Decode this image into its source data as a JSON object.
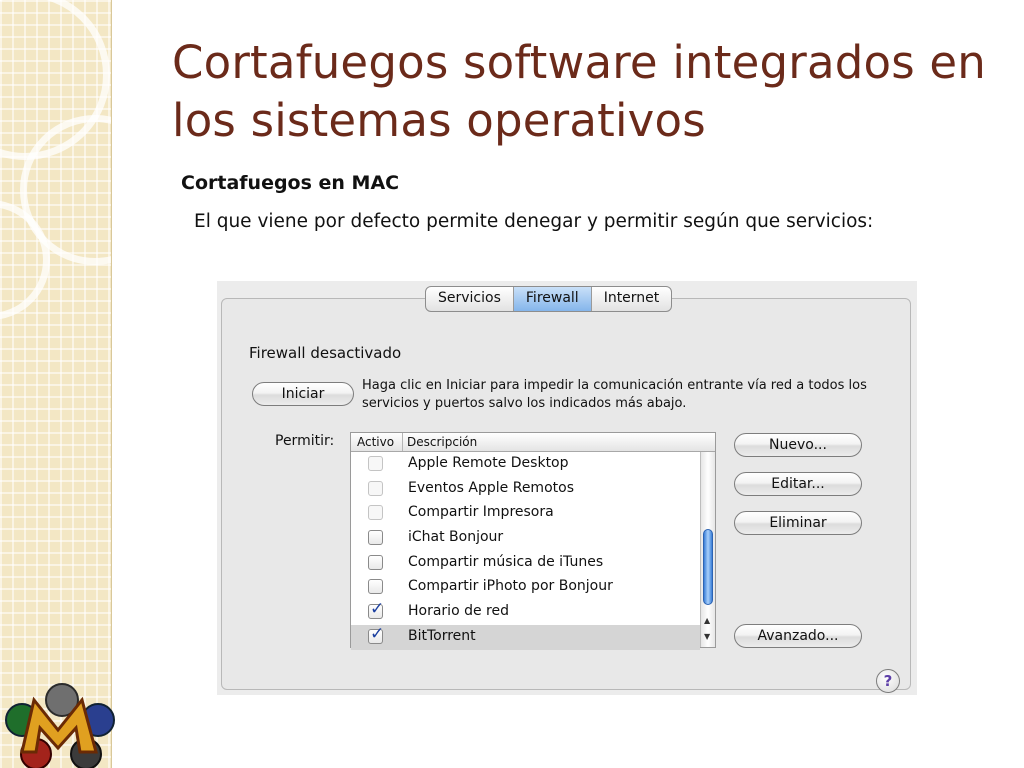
{
  "slide": {
    "title": "Cortafuegos software integrados en los sistemas operativos",
    "subtitle": "Cortafuegos en MAC",
    "body": "El que viene por defecto permite denegar y permitir según que servicios:"
  },
  "pane": {
    "tabs": [
      {
        "label": "Servicios",
        "active": false
      },
      {
        "label": "Firewall",
        "active": true
      },
      {
        "label": "Internet",
        "active": false
      }
    ],
    "status": "Firewall desactivado",
    "start_button": "Iniciar",
    "info": "Haga clic en Iniciar para impedir la comunicación entrante vía red a todos los servicios y puertos salvo los indicados más abajo.",
    "allow_label": "Permitir:",
    "list": {
      "headers": [
        "Activo",
        "Descripción"
      ],
      "rows": [
        {
          "label": "Apple Remote Desktop",
          "checked": false,
          "enabled": false
        },
        {
          "label": "Eventos Apple Remotos",
          "checked": false,
          "enabled": false
        },
        {
          "label": "Compartir Impresora",
          "checked": false,
          "enabled": false
        },
        {
          "label": "iChat Bonjour",
          "checked": false,
          "enabled": true
        },
        {
          "label": "Compartir música de iTunes",
          "checked": false,
          "enabled": true
        },
        {
          "label": "Compartir iPhoto por Bonjour",
          "checked": false,
          "enabled": true
        },
        {
          "label": "Horario de red",
          "checked": true,
          "enabled": true
        },
        {
          "label": "BitTorrent",
          "checked": true,
          "enabled": true,
          "selected": true
        }
      ]
    },
    "buttons": {
      "new": "Nuevo...",
      "edit": "Editar...",
      "delete": "Eliminar",
      "advanced": "Avanzado..."
    },
    "help": "?"
  },
  "icons": {
    "logo": "magic-m-logo-icon",
    "help": "help-icon",
    "checkbox": "checkbox-icon",
    "scroll_up": "arrow-up-icon",
    "scroll_down": "arrow-down-icon"
  },
  "colors": {
    "title": "#6b2a1a",
    "band": "#f3e7c4",
    "active_tab": "#7fb2ea",
    "check": "#1b3fa0"
  }
}
